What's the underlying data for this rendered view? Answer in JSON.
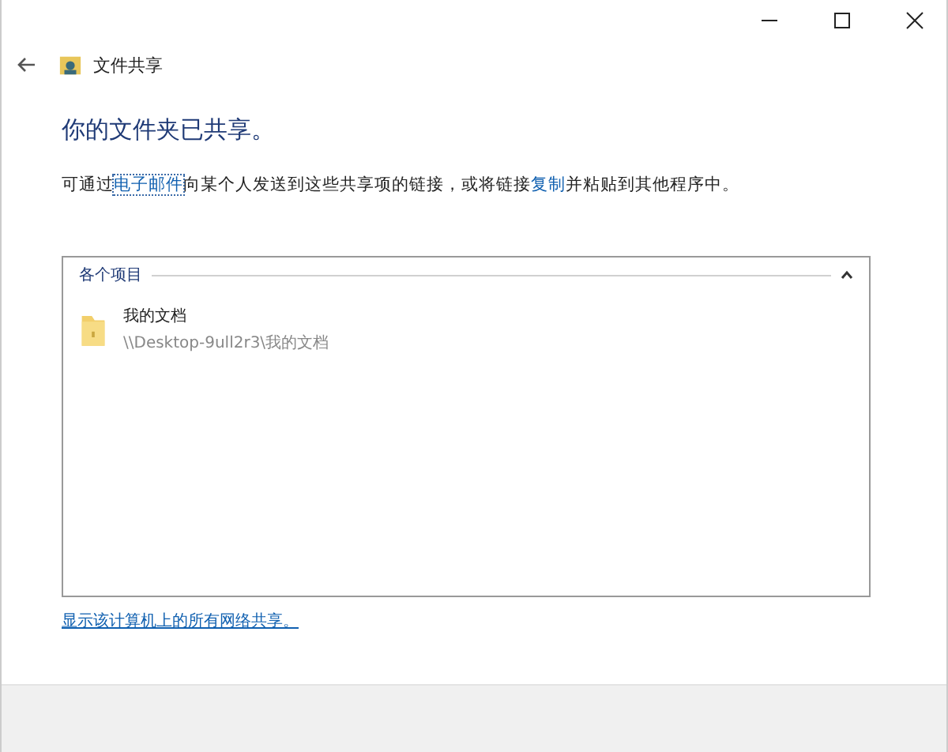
{
  "window": {
    "title": "文件共享"
  },
  "heading": "你的文件夹已共享。",
  "description": [
    {
      "kind": "text",
      "text": "可通过"
    },
    {
      "kind": "link",
      "text": "电子邮件",
      "focused": true
    },
    {
      "kind": "text",
      "text": "向某个人发送到这些共享项的链接，或将链接"
    },
    {
      "kind": "link",
      "text": "复制",
      "focused": false
    },
    {
      "kind": "text",
      "text": "并粘贴到其他程序中。"
    }
  ],
  "group": {
    "title": "各个项目",
    "expanded": true,
    "items": [
      {
        "name": "我的文档",
        "path": "\\\\Desktop-9ull2r3\\我的文档"
      }
    ]
  },
  "footer_link": "显示该计算机上的所有网络共享。"
}
